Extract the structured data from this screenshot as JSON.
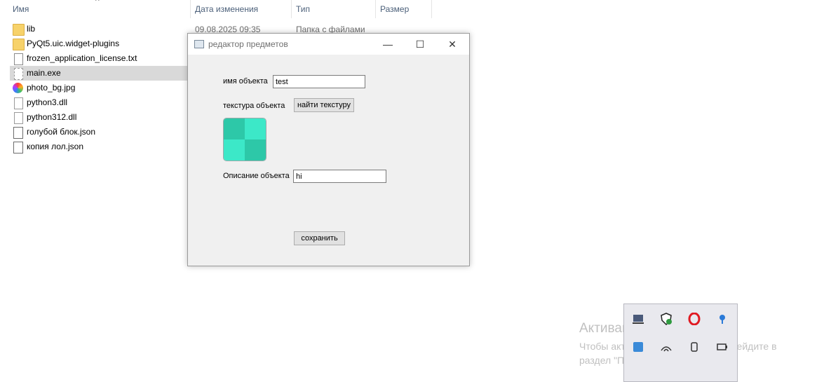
{
  "explorer": {
    "columns": {
      "name": "Имя",
      "date": "Дата изменения",
      "type": "Тип",
      "size": "Размер"
    },
    "files": [
      {
        "name": "lib",
        "icon": "folder-icon",
        "date": "09.08.2025 09:35",
        "type": "Папка с файлами"
      },
      {
        "name": "PyQt5.uic.widget-plugins",
        "icon": "folder-icon"
      },
      {
        "name": "frozen_application_license.txt",
        "icon": "text-file-icon"
      },
      {
        "name": "main.exe",
        "icon": "executable-icon"
      },
      {
        "name": "photo_bg.jpg",
        "icon": "image-file-icon"
      },
      {
        "name": "python3.dll",
        "icon": "dll-file-icon"
      },
      {
        "name": "python312.dll",
        "icon": "dll-file-icon"
      },
      {
        "name": "голубой блок.json",
        "icon": "json-file-icon"
      },
      {
        "name": "копия лол.json",
        "icon": "json-file-icon"
      }
    ]
  },
  "dialog": {
    "title": "редактор предметов",
    "name_label": "имя объекта",
    "name_value": "test",
    "texture_label": "текстура объекта",
    "find_texture_button": "найти текстуру",
    "description_label": "Описание объекта",
    "description_value": "hi",
    "save_button": "сохранить",
    "texture_colors": [
      "#2dc8a8",
      "#3ce8c8"
    ]
  },
  "watermark": {
    "line1": "Активация Windows",
    "line2": "Чтобы активировать Windows, перейдите в",
    "line3": "раздел \"Параметры\"."
  },
  "tray": {
    "icons": [
      "monitor-icon",
      "shield-icon",
      "opera-icon",
      "location-pin-icon",
      "app-icon",
      "wifi-icon",
      "usb-icon",
      "battery-icon"
    ]
  }
}
